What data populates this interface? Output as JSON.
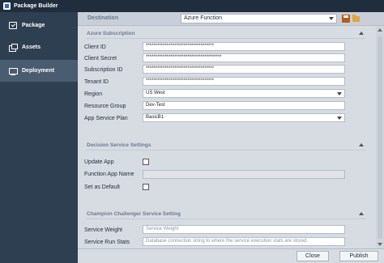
{
  "window": {
    "title": "Package Builder"
  },
  "sidebar": {
    "items": [
      {
        "label": "Package",
        "icon": "package-icon"
      },
      {
        "label": "Assets",
        "icon": "assets-icon"
      },
      {
        "label": "Deployment",
        "icon": "deployment-icon",
        "active": true
      }
    ]
  },
  "destination": {
    "label": "Destination",
    "value": "Azure Function"
  },
  "azure_subscription": {
    "header": "Azure Subscription",
    "client_id": {
      "label": "Client ID",
      "value": "************************************"
    },
    "client_secret": {
      "label": "Client Secret",
      "value": "****************************************"
    },
    "subscription_id": {
      "label": "Subscription ID",
      "value": "************************************"
    },
    "tenant_id": {
      "label": "Tenant ID",
      "value": "************************************"
    },
    "region": {
      "label": "Region",
      "value": "US West"
    },
    "resource_group": {
      "label": "Resource Group",
      "value": "Dev-Test"
    },
    "app_service_plan": {
      "label": "App Service Plan",
      "value": "BasicB1"
    }
  },
  "decision_service": {
    "header": "Decision Service Settings",
    "update_app": {
      "label": "Update App",
      "checked": false
    },
    "function_app_name": {
      "label": "Function App Name",
      "value": ""
    },
    "set_as_default": {
      "label": "Set as Default",
      "checked": false
    }
  },
  "champion_challenger": {
    "header": "Champion Challenger Service Setting",
    "service_weight": {
      "label": "Service Weight",
      "placeholder": "Service Weight"
    },
    "service_run_stats": {
      "label": "Service Run Stats",
      "placeholder": "Database connection string to where the service execution stats are stored."
    }
  },
  "footer": {
    "close_label": "Close",
    "publish_label": "Publish"
  }
}
